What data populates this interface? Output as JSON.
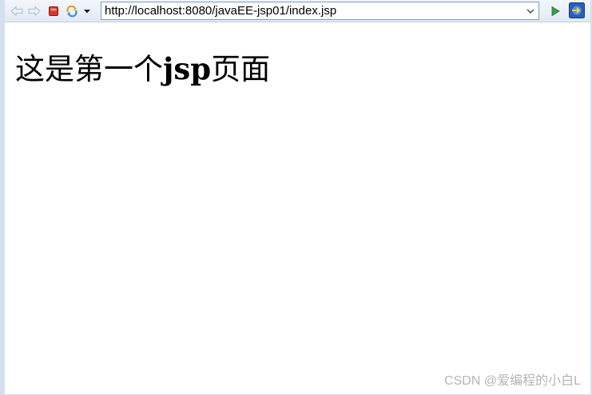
{
  "toolbar": {
    "icons": {
      "back": "back-arrow-icon",
      "forward": "forward-arrow-icon",
      "stop": "stop-icon",
      "refresh": "refresh-icon",
      "history": "chevron-down-icon",
      "go": "go-arrow-icon",
      "external": "open-external-browser-icon"
    },
    "colors": {
      "stop": "#d9342b",
      "go": "#3aa04a",
      "external": "#2a5fb8",
      "nav_arrow": "#b8c4d6"
    }
  },
  "address_bar": {
    "url": "http://localhost:8080/javaEE-jsp01/index.jsp"
  },
  "page": {
    "heading_part1": "这是第一个",
    "heading_part2": "jsp",
    "heading_part3": "页面"
  },
  "watermark": "CSDN @爱编程的小白L"
}
